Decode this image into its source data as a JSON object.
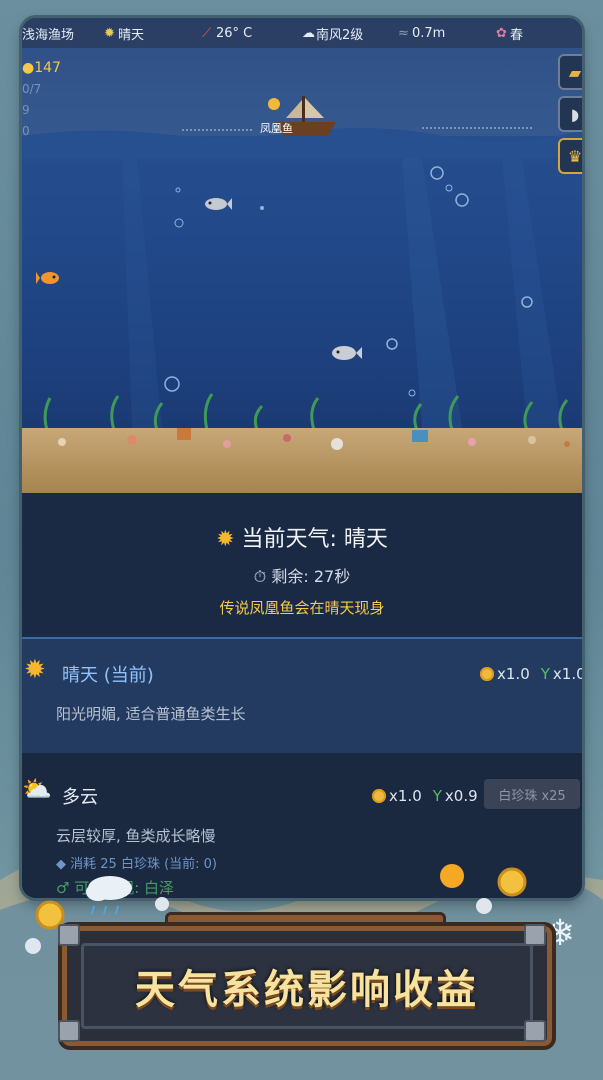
{
  "status_bar": {
    "location": "浅海渔场",
    "weather": "晴天",
    "temperature": "26° C",
    "wind": "南风2级",
    "depth": "0.7m",
    "season": "春"
  },
  "stats": {
    "coins": "147",
    "fish_count": "0/7",
    "line2": "9",
    "line3": "0"
  },
  "ship": {
    "label": "凤凰鱼"
  },
  "current_weather": {
    "title": "当前天气: 晴天",
    "remaining": "剩余: 27秒",
    "hint": "传说凤凰鱼会在晴天现身"
  },
  "weather_options": [
    {
      "name": "晴天 (当前)",
      "icon": "sun-icon",
      "coin_mult": "x1.0",
      "growth_mult": "x1.0",
      "description": "阳光明媚, 适合普通鱼类生长"
    },
    {
      "name": "多云",
      "icon": "cloudy-icon",
      "coin_mult": "x1.0",
      "growth_mult": "x0.9",
      "description": "云层较厚, 鱼类成长略慢",
      "cost": "消耗 25 白珍珠 (当前: 0)",
      "appear": "可能出现: 白泽",
      "button": "白珍珠 x25"
    }
  ],
  "banner": {
    "text": "天气系统影响收益"
  },
  "colors": {
    "accent": "#3c6aa5",
    "gold": "#f6c94e",
    "sand": "#c8a878",
    "ocean": "#22498a"
  }
}
